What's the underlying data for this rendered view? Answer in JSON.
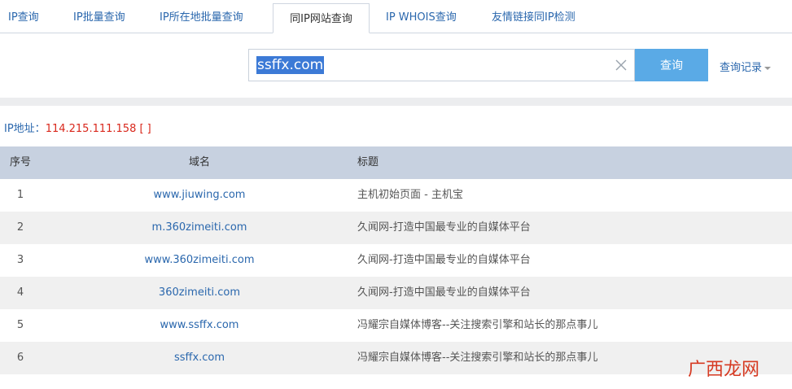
{
  "tabs": [
    {
      "label": "IP查询",
      "active": false
    },
    {
      "label": "IP批量查询",
      "active": false
    },
    {
      "label": "IP所在地批量查询",
      "active": false
    },
    {
      "label": "同IP网站查询",
      "active": true
    },
    {
      "label": "IP WHOIS查询",
      "active": false
    },
    {
      "label": "友情链接同IP检测",
      "active": false
    }
  ],
  "search": {
    "value": "ssffx.com",
    "button_label": "查询",
    "history_label": "查询记录"
  },
  "ip_info": {
    "label": "IP地址：",
    "value": "114.215.111.158 [ ]"
  },
  "table": {
    "headers": [
      "序号",
      "域名",
      "标题"
    ],
    "rows": [
      {
        "no": "1",
        "domain": "www.jiuwing.com",
        "title": "主机初始页面 - 主机宝"
      },
      {
        "no": "2",
        "domain": "m.360zimeiti.com",
        "title": "久闻网-打造中国最专业的自媒体平台"
      },
      {
        "no": "3",
        "domain": "www.360zimeiti.com",
        "title": "久闻网-打造中国最专业的自媒体平台"
      },
      {
        "no": "4",
        "domain": "360zimeiti.com",
        "title": "久闻网-打造中国最专业的自媒体平台"
      },
      {
        "no": "5",
        "domain": "www.ssffx.com",
        "title": "冯耀宗自媒体博客--关注搜索引擎和站长的那点事儿"
      },
      {
        "no": "6",
        "domain": "ssffx.com",
        "title": "冯耀宗自媒体博客--关注搜索引擎和站长的那点事儿"
      }
    ]
  },
  "watermark": {
    "text": "广西龙网"
  },
  "colors": {
    "link": "#2a67ad",
    "ip_value": "#d9281c",
    "button_bg": "#5aaae6",
    "table_header_bg": "#c7d1e0",
    "row_alt_bg": "#f0f0f0"
  }
}
